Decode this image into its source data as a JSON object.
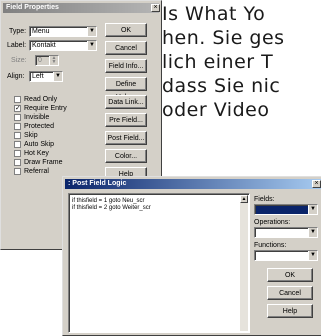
{
  "background_text": [
    "Is What Yo",
    "hen. Sie ges",
    "lich einer T",
    "dass Sie nic",
    "oder Video"
  ],
  "field_properties": {
    "title": "Field Properties",
    "type_label": "Type:",
    "type_value": "Menu",
    "label_label": "Label:",
    "label_value": "Kontakt",
    "size_label": "Size:",
    "size_value": "0",
    "align_label": "Align:",
    "align_value": "Left",
    "checkboxes": [
      {
        "label": "Read Only",
        "checked": false
      },
      {
        "label": "Require Entry",
        "checked": true
      },
      {
        "label": "Invisible",
        "checked": false
      },
      {
        "label": "Protected",
        "checked": false
      },
      {
        "label": "Skip",
        "checked": false
      },
      {
        "label": "Auto Skip",
        "checked": false
      },
      {
        "label": "Hot Key",
        "checked": false
      },
      {
        "label": "Draw Frame",
        "checked": false
      },
      {
        "label": "Referral",
        "checked": false
      }
    ],
    "buttons": [
      "OK",
      "Cancel",
      "Field Info...",
      "Define Help...",
      "Data Link...",
      "Pre Field...",
      "Post Field...",
      "Color...",
      "Help"
    ]
  },
  "post_field_logic": {
    "title": ": Post Field Logic",
    "code_lines": [
      "if thisfield = 1 goto Neu_scr",
      "if thisfield = 2 goto Weiter_scr"
    ],
    "fields_label": "Fields:",
    "operations_label": "Operations:",
    "functions_label": "Functions:",
    "buttons": [
      "OK",
      "Cancel",
      "Help"
    ]
  }
}
